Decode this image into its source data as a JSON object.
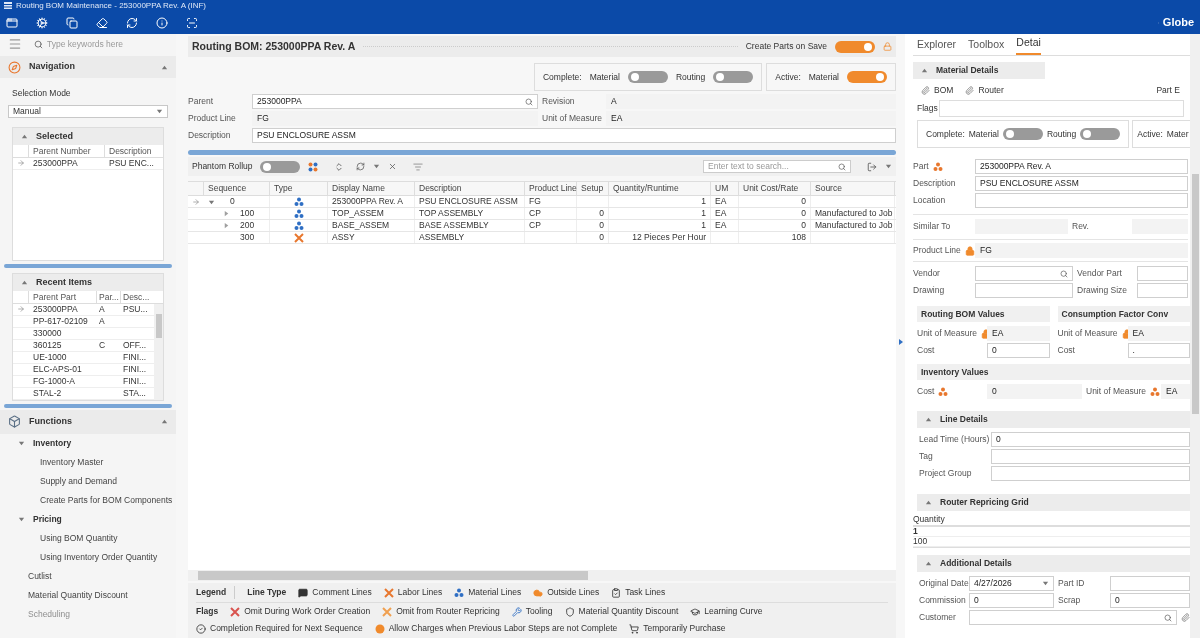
{
  "window": {
    "title": "Routing BOM Maintenance - 253000PPA Rev. A (INF)",
    "brand": "Globe"
  },
  "sidebar": {
    "search_placeholder": "Type keywords here",
    "navigation": {
      "title": "Navigation",
      "expanded": true,
      "mode_label": "Selection Mode",
      "mode": "Manual",
      "selected": {
        "title": "Selected",
        "expanded": true,
        "columns": [
          "Parent Number",
          "Description"
        ],
        "rows": [
          {
            "part": "253000PPA",
            "desc": "PSU ENC...",
            "current": true
          }
        ]
      },
      "recent": {
        "title": "Recent Items",
        "expanded": true,
        "columns": [
          "Parent Part",
          "Par...",
          "Desc..."
        ],
        "rows": [
          {
            "part": "253000PPA",
            "rev": "A",
            "desc": "PSU...",
            "current": true
          },
          {
            "part": "PP-617-02109",
            "rev": "A",
            "current": false
          },
          {
            "part": "330000",
            "current": false
          },
          {
            "part": "360125",
            "rev": "C",
            "desc": "OFF...",
            "current": false
          },
          {
            "part": "UE-1000",
            "desc": "FINI...",
            "current": false
          },
          {
            "part": "ELC-APS-01",
            "desc": "FINI...",
            "current": false
          },
          {
            "part": "FG-1000-A",
            "desc": "FINI...",
            "current": false
          },
          {
            "part": "STAL-2",
            "desc": "STA...",
            "current": false
          }
        ]
      }
    },
    "functions": {
      "title": "Functions",
      "expanded": true,
      "items": [
        {
          "kind": "group",
          "label": "Inventory",
          "expanded": true,
          "children": [
            {
              "label": "Inventory Master",
              "disabled": false
            },
            {
              "label": "Supply and Demand",
              "disabled": false
            },
            {
              "label": "Create Parts for BOM Components",
              "disabled": false
            }
          ]
        },
        {
          "kind": "group",
          "label": "Pricing",
          "expanded": true,
          "children": [
            {
              "label": "Using BOM Quantity",
              "disabled": false
            },
            {
              "label": "Using Inventory Order Quantity",
              "disabled": false
            }
          ]
        },
        {
          "kind": "item",
          "label": "Cutlist",
          "disabled": false
        },
        {
          "kind": "item",
          "label": "Material Quantity Discount",
          "disabled": false
        },
        {
          "kind": "item",
          "label": "Scheduling",
          "disabled": true
        }
      ]
    }
  },
  "document": {
    "title": "Routing BOM: 253000PPA Rev. A",
    "create_parts": {
      "label": "Create Parts on Save",
      "on": true
    },
    "complete": {
      "label": "Complete:",
      "toggles": [
        {
          "label": "Material",
          "on": false
        },
        {
          "label": "Routing",
          "on": false
        }
      ]
    },
    "active": {
      "label": "Active:",
      "toggles": [
        {
          "label": "Material",
          "on": true
        }
      ]
    },
    "rows": [
      [
        {
          "kind": "search",
          "label": "Parent",
          "value": "253000PPA",
          "readonly": false
        },
        {
          "kind": "plain",
          "label": "Revision",
          "value": "A",
          "readonly": true
        }
      ],
      [
        {
          "kind": "plain",
          "label": "Product Line",
          "value": "FG",
          "readonly": true
        },
        {
          "kind": "plain",
          "label": "Unit of Measure",
          "value": "EA",
          "readonly": true
        }
      ],
      [
        {
          "kind": "plain",
          "label": "Description",
          "value": "PSU ENCLOSURE ASSM",
          "readonly": false
        }
      ]
    ],
    "grid_toolbar": {
      "phantom_label": "Phantom Rollup",
      "phantom_on": false,
      "search_placeholder": "Enter text to search..."
    },
    "table": {
      "columns": [
        "Sequence",
        "Type",
        "Display Name",
        "Description",
        "Product Line",
        "Setup",
        "Quantity/Runtime",
        "UM",
        "Unit Cost/Rate",
        "Source"
      ],
      "rows": [
        {
          "sequence": "0",
          "kind": "material",
          "expandable": true,
          "expanded": true,
          "current": true,
          "display_name": "253000PPA Rev. A",
          "description": "PSU ENCLOSURE ASSM",
          "product_line": "FG",
          "quantity": "1",
          "um": "EA",
          "unit_cost": "0",
          "children": [
            {
              "sequence": "100",
              "kind": "material",
              "expandable": true,
              "expanded": false,
              "current": false,
              "display_name": "TOP_ASSEM",
              "description": "TOP ASSEMBLY",
              "product_line": "CP",
              "setup": "0",
              "quantity": "1",
              "um": "EA",
              "unit_cost": "0",
              "source": "Manufactured to Job"
            },
            {
              "sequence": "200",
              "kind": "material",
              "expandable": true,
              "expanded": false,
              "current": false,
              "display_name": "BASE_ASSEM",
              "description": "BASE ASSEMBLY",
              "product_line": "CP",
              "setup": "0",
              "quantity": "1",
              "um": "EA",
              "unit_cost": "0",
              "source": "Manufactured to Job"
            },
            {
              "sequence": "300",
              "kind": "labor",
              "expandable": false,
              "current": false,
              "display_name": "ASSY",
              "description": "ASSEMBLY",
              "setup": "0",
              "quantity": "12 Pieces Per Hour",
              "unit_cost": "108"
            }
          ]
        }
      ]
    },
    "legend": {
      "title": "Legend",
      "line_type_label": "Line Type",
      "line_types": [
        {
          "kind": "comment",
          "label": "Comment Lines"
        },
        {
          "kind": "labor",
          "label": "Labor Lines"
        },
        {
          "kind": "material",
          "label": "Material Lines"
        },
        {
          "kind": "outside",
          "label": "Outside Lines"
        },
        {
          "kind": "task",
          "label": "Task Lines"
        }
      ],
      "flags_label": "Flags",
      "flag_lines": [
        [
          {
            "kind": "omit_wo",
            "label": "Omit During Work Order Creation"
          },
          {
            "kind": "omit_repricing",
            "label": "Omit from Router Repricing"
          },
          {
            "kind": "tooling",
            "label": "Tooling"
          },
          {
            "kind": "discount",
            "label": "Material Quantity Discount"
          },
          {
            "kind": "learning",
            "label": "Learning Curve"
          }
        ],
        [
          {
            "kind": "completion",
            "label": "Completion Required for Next Sequence"
          },
          {
            "kind": "charges",
            "label": "Allow Charges when Previous Labor Steps are not Complete"
          },
          {
            "kind": "purchase",
            "label": "Temporarily Purchase"
          }
        ]
      ]
    }
  },
  "details": {
    "tabs": [
      {
        "label": "Explorer",
        "selected": false
      },
      {
        "label": "Toolbox",
        "selected": false
      },
      {
        "label": "Detai",
        "selected": true
      }
    ],
    "material": {
      "title": "Material Details",
      "expanded": true,
      "attachments": [
        "BOM",
        "Router"
      ],
      "part_e": "Part E",
      "flags_label": "Flags",
      "complete": {
        "label": "Complete:",
        "toggles": [
          {
            "label": "Material",
            "on": false
          },
          {
            "label": "Routing",
            "on": false
          }
        ]
      },
      "active": {
        "label": "Active:",
        "text": "Mater"
      },
      "rows": [
        [
          {
            "kind": "part",
            "label": "Part",
            "value": "253000PPA Rev. A",
            "readonly": false
          }
        ],
        [
          {
            "kind": "plain",
            "label": "Description",
            "value": "PSU ENCLOSURE ASSM",
            "readonly": false
          }
        ],
        [
          {
            "kind": "plain",
            "label": "Location",
            "readonly": false
          }
        ],
        [
          {
            "kind": "plain",
            "label": "Similar To",
            "readonly": true
          },
          {
            "kind": "plain",
            "label": "Rev.",
            "readonly": true
          }
        ],
        [
          {
            "kind": "locked",
            "label": "Product Line",
            "value": "FG",
            "readonly": true
          }
        ],
        [
          {
            "kind": "search",
            "label": "Vendor",
            "readonly": false
          },
          {
            "kind": "plain",
            "label": "Vendor Part",
            "readonly": false
          }
        ],
        [
          {
            "kind": "plain",
            "label": "Drawing",
            "readonly": false
          },
          {
            "kind": "plain",
            "label": "Drawing Size",
            "readonly": false
          }
        ]
      ]
    },
    "values": [
      {
        "title": "Routing BOM Values",
        "fields": [
          {
            "kind": "locked",
            "label": "Unit of Measure",
            "value": "EA",
            "readonly": true
          },
          {
            "kind": "plain",
            "label": "Cost",
            "value": "0",
            "readonly": false
          }
        ]
      },
      {
        "title": "Consumption Factor Conv",
        "fields": [
          {
            "kind": "locked",
            "label": "Unit of Measure",
            "value": "EA",
            "readonly": true
          },
          {
            "kind": "plain",
            "label": "Cost",
            "value": ".",
            "readonly": false
          }
        ]
      }
    ],
    "inventory": {
      "title": "Inventory Values",
      "fields": [
        {
          "kind": "rolled",
          "label": "Cost",
          "value": "0",
          "readonly": true
        },
        {
          "kind": "rolled",
          "label": "Unit of Measure",
          "value": "EA",
          "readonly": true
        }
      ]
    },
    "line_details": {
      "title": "Line Details",
      "expanded": true,
      "rows": [
        [
          {
            "label": "Lead Time (Hours)",
            "value": "0",
            "readonly": false
          }
        ],
        [
          {
            "label": "Tag",
            "readonly": false
          }
        ],
        [
          {
            "label": "Project Group",
            "readonly": false
          }
        ]
      ]
    },
    "repricing": {
      "title": "Router Repricing Grid",
      "expanded": true,
      "column": "Quantity",
      "rows": [
        "1",
        "100"
      ]
    },
    "additional": {
      "title": "Additional Details",
      "expanded": true,
      "rows": [
        [
          {
            "kind": "dropdown",
            "label": "Original Date",
            "value": "4/27/2026",
            "readonly": false
          },
          {
            "kind": "plain",
            "label": "Part ID",
            "readonly": false
          }
        ],
        [
          {
            "kind": "plain",
            "label": "Commission",
            "value": "0",
            "readonly": false
          },
          {
            "kind": "plain",
            "label": "Scrap",
            "value": "0",
            "readonly": false
          }
        ],
        [
          {
            "kind": "search",
            "label": "Customer",
            "readonly": false
          }
        ]
      ]
    }
  }
}
